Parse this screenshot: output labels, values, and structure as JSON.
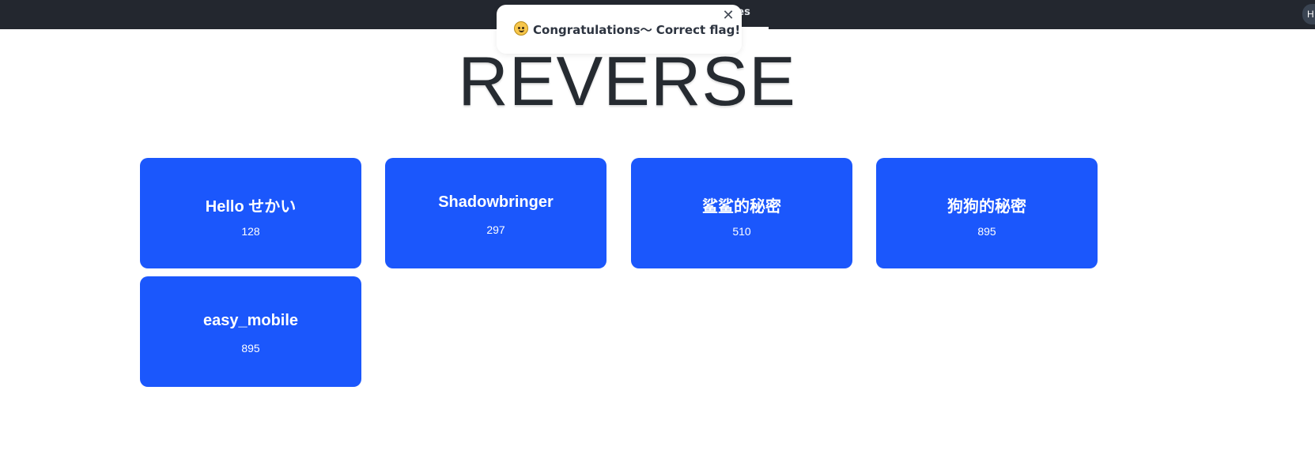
{
  "navbar": {
    "active_link_fragment": "ges",
    "user_pill_text": "H"
  },
  "toast": {
    "message": "Congratulations～ Correct flag!",
    "close_symbol": "✕"
  },
  "page": {
    "title": "REVERSE"
  },
  "challenges": [
    {
      "title": "Hello せかい",
      "score": "128"
    },
    {
      "title": "Shadowbringer",
      "score": "297"
    },
    {
      "title": "鲨鲨的秘密",
      "score": "510"
    },
    {
      "title": "狗狗的秘密",
      "score": "895"
    },
    {
      "title": "easy_mobile",
      "score": "895"
    }
  ],
  "colors": {
    "navbar_bg": "#23272f",
    "card_bg": "#1b57fc",
    "title_text": "#262b31"
  }
}
